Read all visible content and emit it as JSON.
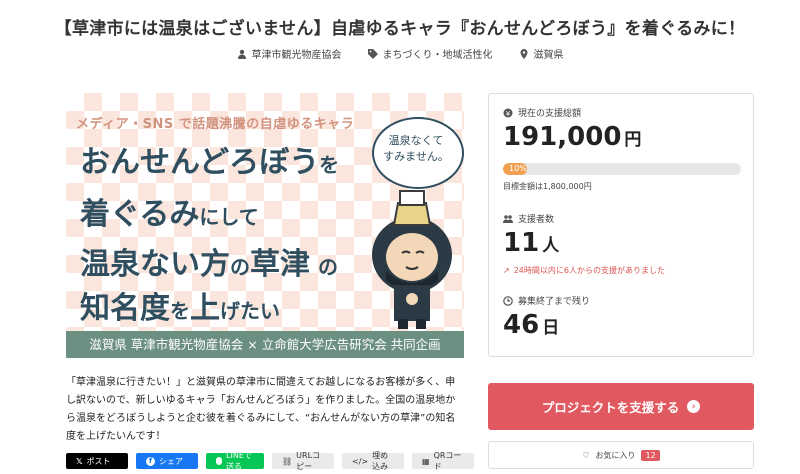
{
  "title": "【草津市には温泉はございません】自虐ゆるキャラ『おんせんどろぼう』を着ぐるみに！",
  "meta": {
    "owner": "草津市観光物産協会",
    "category": "まちづくり・地域活性化",
    "location": "滋賀県"
  },
  "hero": {
    "tagline": "メディア・SNS で話題沸騰の自虐ゆるキャラ",
    "line1a": "おんせんどろぼう",
    "line1b": "を",
    "line2a": "着ぐるみ",
    "line2b": "にして",
    "line3a": "温泉ない方",
    "line3b": "の",
    "line3c": "草津",
    "line3d": "の",
    "line4a": "知名度",
    "line4b": "を",
    "line4c": "上",
    "line4d": "げたい",
    "bubble_line1": "温泉なくて",
    "bubble_line2": "すみません。",
    "footer": "滋賀県 草津市観光物産協会 × 立命館大学広告研究会 共同企画"
  },
  "description": "「草津温泉に行きたい！」と滋賀県の草津市に間違えてお越しになるお客様が多く、申し訳ないので、新しいゆるキャラ「おんせんどろぼう」を作りました。全国の温泉地から温泉をどろぼうしようと企む彼を着ぐるみにして、“おんせんがない方の草津”の知名度を上げたいんです！",
  "share": {
    "x_label": "ポスト",
    "facebook_label": "シェア",
    "line_label": "LINEで送る",
    "url_label": "URLコピー",
    "embed_label": "埋め込み",
    "qr_label": "QRコード"
  },
  "stats": {
    "total_label": "現在の支援総額",
    "total_amount": "191,000",
    "currency_unit": "円",
    "progress_percent": 10,
    "progress_text": "10%",
    "goal_text": "目標金額は1,800,000円",
    "supporters_label": "支援者数",
    "supporters_count": "11",
    "supporters_unit": "人",
    "trend_text": "24時間以内に6人からの支援がありました",
    "remaining_label": "募集終了まで残り",
    "remaining_days": "46",
    "remaining_unit": "日"
  },
  "actions": {
    "support_label": "プロジェクトを支援する",
    "favorite_label": "お気に入り",
    "favorite_count": "12"
  },
  "colors": {
    "accent": "#e15960",
    "progress": "#f0a050",
    "hero_text": "#2f4e5f",
    "hero_footer": "#6b8f80",
    "hero_tag": "#d2937e"
  }
}
